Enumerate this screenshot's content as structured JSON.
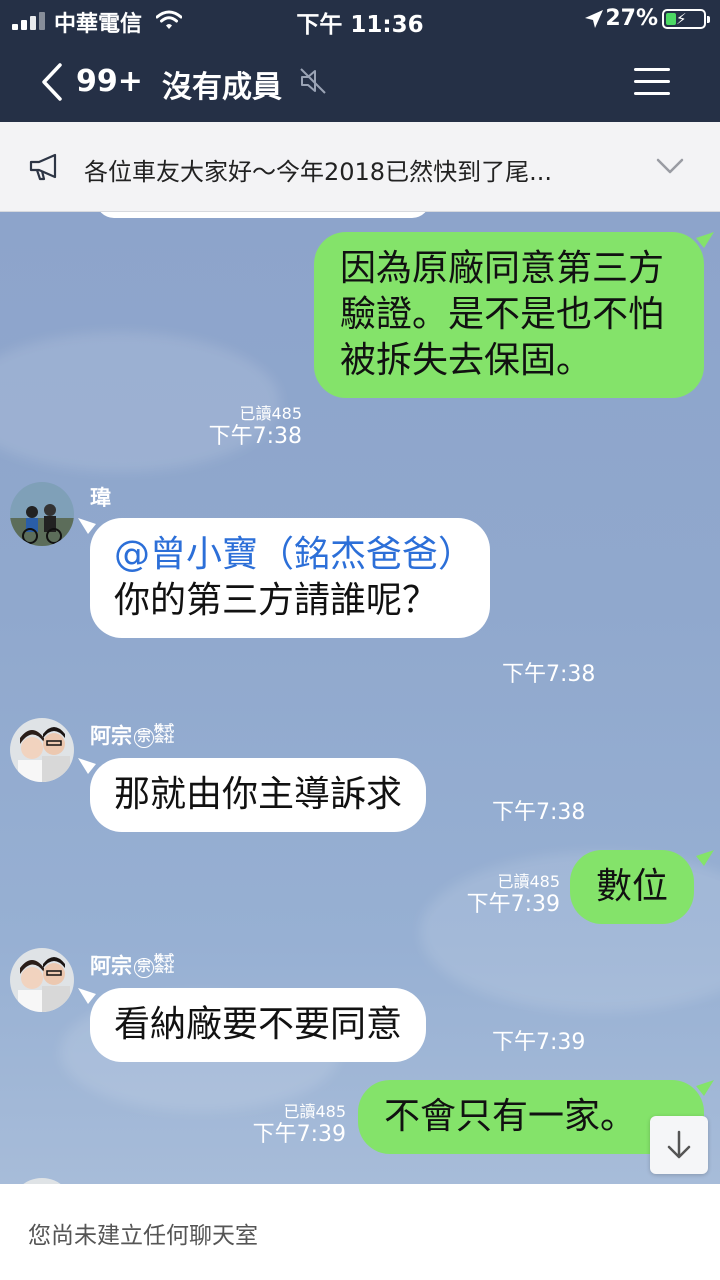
{
  "status_bar": {
    "carrier": "中華電信",
    "time": "下午 11:36",
    "battery": "27%",
    "battery_level": 0.27
  },
  "header": {
    "unread_count": "99+",
    "title": "沒有成員"
  },
  "announcement": {
    "text": "各位車友大家好～今年2018已然快到了尾..."
  },
  "messages": [
    {
      "type": "out",
      "text": "因為原廠同意第三方驗證。是不是也不怕被拆失去保固。",
      "read": "已讀485",
      "time": "下午7:38"
    },
    {
      "type": "in",
      "sender": "瑋",
      "mention": "@曾小寶（銘杰爸爸）",
      "text": "你的第三方請誰呢？",
      "time": "下午7:38"
    },
    {
      "type": "in",
      "sender": "阿宗",
      "sender_badge": "宗",
      "sender_corp": "株式会社",
      "text": "那就由你主導訴求",
      "time": "下午7:38"
    },
    {
      "type": "out",
      "text": "數位",
      "read": "已讀485",
      "time": "下午7:39"
    },
    {
      "type": "in",
      "sender": "阿宗",
      "sender_badge": "宗",
      "sender_corp": "株式会社",
      "text": "看納廠要不要同意",
      "time": "下午7:39"
    },
    {
      "type": "out",
      "text": "不會只有一家。",
      "read": "已讀485",
      "time": "下午7:39"
    }
  ],
  "bottom_bar": {
    "message": "您尚未建立任何聊天室"
  },
  "colors": {
    "header_bg": "#253046",
    "chat_bg": "#8fa6cc",
    "outgoing_bubble": "#84e36a",
    "incoming_bubble": "#ffffff",
    "mention": "#2c6fd8",
    "battery_charging": "#4cd964"
  },
  "icons": [
    "signal-icon",
    "wifi-icon",
    "location-icon",
    "battery-icon",
    "back-icon",
    "mute-icon",
    "menu-icon",
    "megaphone-icon",
    "chevron-down-icon",
    "scroll-down-icon"
  ]
}
